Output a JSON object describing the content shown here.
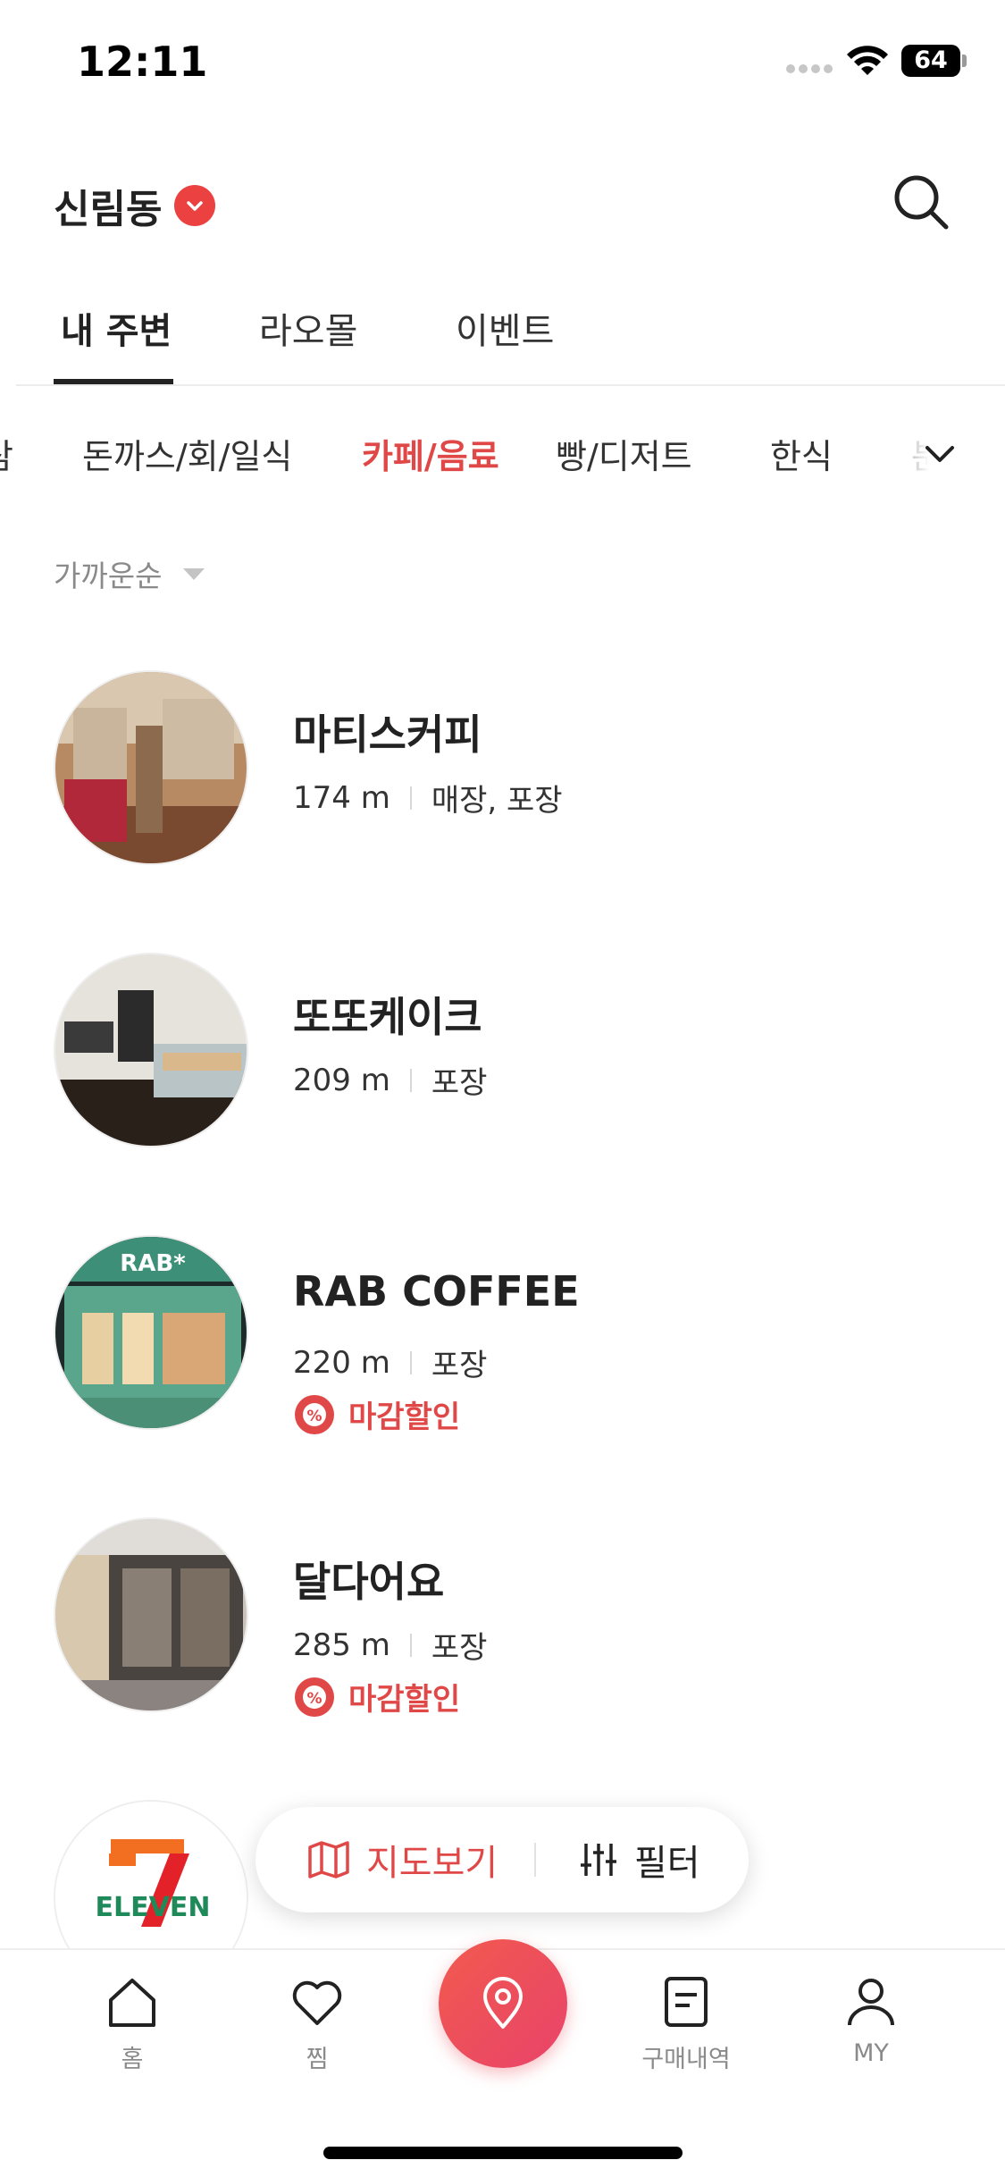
{
  "status_bar": {
    "time": "12:11",
    "battery": "64"
  },
  "header": {
    "location": "신림동"
  },
  "main_tabs": [
    {
      "label": "내 주변",
      "active": true
    },
    {
      "label": "라오몰",
      "active": false
    },
    {
      "label": "이벤트",
      "active": false
    }
  ],
  "categories": [
    {
      "label": "삼"
    },
    {
      "label": "돈까스/회/일식"
    },
    {
      "label": "카페/음료",
      "active": true
    },
    {
      "label": "빵/디저트"
    },
    {
      "label": "한식"
    },
    {
      "label": "분"
    }
  ],
  "sort": {
    "label": "가까운순"
  },
  "stores": [
    {
      "name": "마티스커피",
      "distance": "174 m",
      "service": "매장, 포장",
      "discount": ""
    },
    {
      "name": "또또케이크",
      "distance": "209 m",
      "service": "포장",
      "discount": ""
    },
    {
      "name": "RAB COFFEE",
      "distance": "220 m",
      "service": "포장",
      "discount": "마감할인"
    },
    {
      "name": "달다어요",
      "distance": "285 m",
      "service": "포장",
      "discount": "마감할인"
    },
    {
      "name": "",
      "distance": "",
      "service": "",
      "discount": "",
      "logo_text": "ELEVEN"
    }
  ],
  "floating_actions": {
    "map": "지도보기",
    "filter": "필터"
  },
  "bottom_nav": [
    {
      "label": "홈",
      "icon": "home-icon"
    },
    {
      "label": "찜",
      "icon": "heart-icon"
    },
    {
      "label": "",
      "icon": "location-pin-icon"
    },
    {
      "label": "구매내역",
      "icon": "receipt-icon"
    },
    {
      "label": "MY",
      "icon": "person-icon"
    }
  ],
  "colors": {
    "accent": "#e04848",
    "nav_gradient_start": "#f25a4e",
    "nav_gradient_end": "#e8436a"
  }
}
